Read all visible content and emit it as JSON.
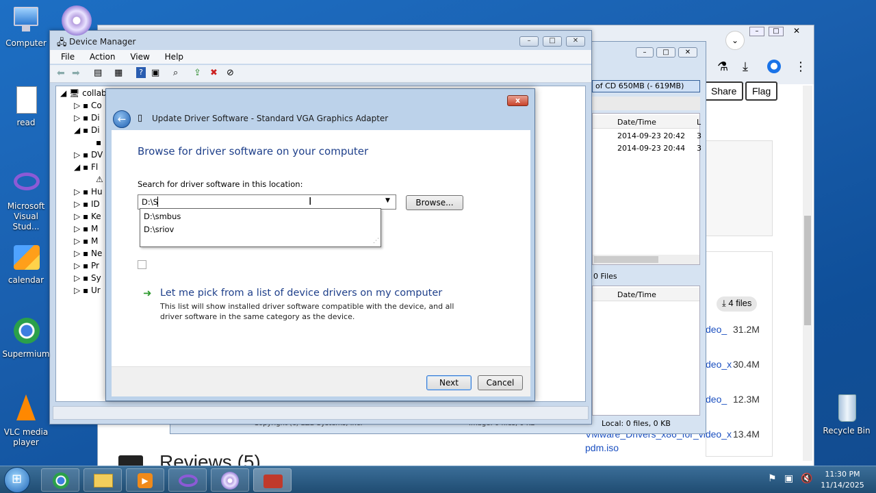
{
  "desktop_icons": [
    "Computer",
    "read",
    "Microsoft Visual Stud...",
    "calendar",
    "Supermium",
    "VLC media player",
    "Recycle Bin"
  ],
  "browser": {
    "share": "Share",
    "flag": "Flag",
    "files_badge": "4 files",
    "reviews": "Reviews (5)",
    "file_rows": [
      {
        "name": "deo_",
        "size": "31.2M"
      },
      {
        "name": "deo_x",
        "size": "30.4M"
      },
      {
        "name": "deo_",
        "size": "12.3M"
      },
      {
        "name": "VMware_Drivers_x86_for_video_x",
        "size": "13.4M"
      },
      {
        "name": "pdm.iso",
        "size": ""
      }
    ]
  },
  "explorer": {
    "cd_label": "of CD 650MB (- 619MB)",
    "col_datetime": "Date/Time",
    "col_l": "L",
    "rows": [
      {
        "date": "2014-09-23 20:42",
        "tail": "3"
      },
      {
        "date": "2014-09-23 20:44",
        "tail": "3"
      }
    ],
    "files_label": "0 Files",
    "col_datetime2": "Date/Time",
    "status_local": "Local: 0 files, 0 KB",
    "status_copyright": "Copyright (c) EZB Systems, Inc.",
    "status_image": "Image: 0 files, 0 KB"
  },
  "device_manager": {
    "title": "Device Manager",
    "menu": [
      "File",
      "Action",
      "View",
      "Help"
    ],
    "tree_root": "collab",
    "tree_items": [
      "Co",
      "Di",
      "Di",
      "",
      "DV",
      "Fl",
      "",
      "Hu",
      "ID",
      "Ke",
      "M",
      "M",
      "Ne",
      "Pr",
      "Sy",
      "Ur"
    ]
  },
  "dialog": {
    "title": "Update Driver Software - Standard VGA Graphics Adapter",
    "heading": "Browse for driver software on your computer",
    "search_label": "Search for driver software in this location:",
    "path_value": "D:\\S",
    "suggestions": [
      "D:\\smbus",
      "D:\\sriov"
    ],
    "browse": "Browse...",
    "pick_title": "Let me pick from a list of device drivers on my computer",
    "pick_desc": "This list will show installed driver software compatible with the device, and all driver software in the same category as the device.",
    "next": "Next",
    "cancel": "Cancel",
    "close": "x"
  },
  "taskbar": {
    "time": "11:30 PM",
    "date": "11/14/2025"
  }
}
